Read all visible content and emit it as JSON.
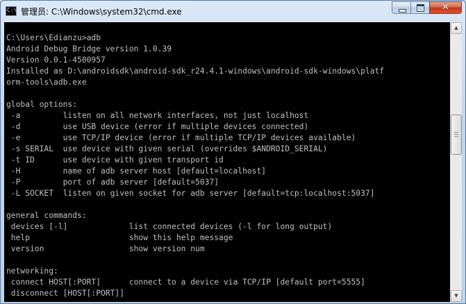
{
  "window": {
    "title": "管理员: C:\\Windows\\system32\\cmd.exe",
    "icon": "cmd-icon",
    "icon_glyph": "C:\\",
    "controls": {
      "minimize": "minimize-icon",
      "maximize": "maximize-icon",
      "close": "close-icon",
      "close_glyph": "✕"
    }
  },
  "console": {
    "lines": [
      "C:\\Users\\Edianzu>adb",
      "Android Debug Bridge version 1.0.39",
      "Version 0.0.1-4500957",
      "Installed as D:\\androidsdk\\android-sdk_r24.4.1-windows\\android-sdk-windows\\platf",
      "orm-tools\\adb.exe",
      "",
      "global options:",
      " -a         listen on all network interfaces, not just localhost",
      " -d         use USB device (error if multiple devices connected)",
      " -e         use TCP/IP device (error if multiple TCP/IP devices available)",
      " -s SERIAL  use device with given serial (overrides $ANDROID_SERIAL)",
      " -t ID      use device with given transport id",
      " -H         name of adb server host [default=localhost]",
      " -P         port of adb server [default=5037]",
      " -L SOCKET  listen on given socket for adb server [default=tcp:localhost:5037]",
      "",
      "general commands:",
      " devices [-l]             list connected devices (-l for long output)",
      " help                     show this help message",
      " version                  show version num",
      "",
      "networking:",
      " connect HOST[:PORT]      connect to a device via TCP/IP [default port=5555]",
      " disconnect [HOST[:PORT]]"
    ],
    "colors": {
      "background": "#000000",
      "foreground": "#c0c0c0"
    }
  },
  "scrollbar": {
    "up_arrow": "▲",
    "down_arrow": "▼"
  }
}
